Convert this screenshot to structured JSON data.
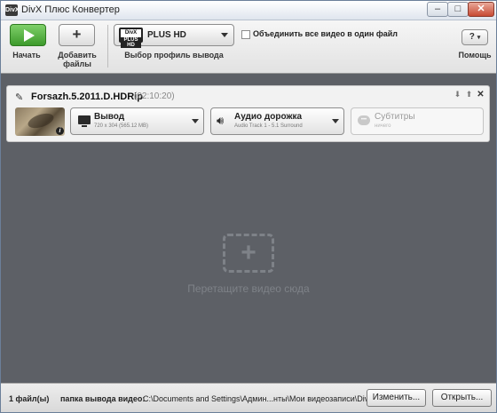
{
  "window": {
    "title": "DivX Плюс Конвертер",
    "app_icon_text": "DivX",
    "controls": {
      "minimize": "–",
      "maximize": "□",
      "close": "✕"
    }
  },
  "toolbar": {
    "start_label": "Начать",
    "add_label_line1": "Добавить",
    "add_label_line2": "файлы",
    "add_icon": "+",
    "profile": {
      "logo_line1": "DivX",
      "logo_line2": "PLUS HD",
      "selected": "PLUS HD",
      "label": "Выбор профиль вывода"
    },
    "merge_checkbox": {
      "label": "Объединить все видео в один файл",
      "checked": false
    },
    "help_button": "?",
    "help_label": "Помощь"
  },
  "file": {
    "name": "Forsazh.5.2011.D.HDRip",
    "duration": "(02:10:20)",
    "video": {
      "title": "Вывод",
      "details": "720 x 304 (565.12 MB)"
    },
    "audio": {
      "title": "Аудио дорожка",
      "details": "Audio Track 1 - 5.1 Surround"
    },
    "subtitles": {
      "title": "Субтитры",
      "details": "ничего"
    },
    "controls": {
      "down": "⬇",
      "up": "⬆",
      "remove": "✕"
    }
  },
  "dropzone": {
    "icon": "+",
    "text": "Перетащите видео сюда"
  },
  "statusbar": {
    "file_count": "1 файл(ы)",
    "output_folder_label": "папка вывода видео:",
    "output_path": "C:\\Documents and Settings\\Админ...нты\\Мои видеозаписи\\DivX Movies",
    "change_button": "Изменить...",
    "open_button": "Открыть..."
  },
  "colors": {
    "start_button": "#4aa836",
    "workspace": "#5d6066",
    "toolbar": "#e9e9e9"
  }
}
